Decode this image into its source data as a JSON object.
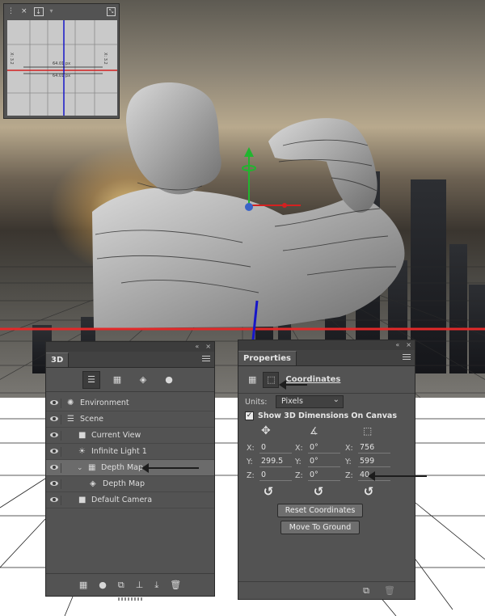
{
  "navigator": {
    "menu_icon": "flyout-menu-icon",
    "x_tag_left": "X: 3.2",
    "x_tag_right": "X: 3.2",
    "measure_top": "64.01 px",
    "measure_bottom": "64.01 px"
  },
  "panel_3d": {
    "tab": "3D",
    "collapse": "«",
    "close": "×",
    "filters": [
      {
        "icon": "scene-filter-icon",
        "active": true
      },
      {
        "icon": "mesh-filter-icon",
        "active": false
      },
      {
        "icon": "material-filter-icon",
        "active": false
      },
      {
        "icon": "light-filter-icon",
        "active": false
      }
    ],
    "layers": [
      {
        "label": "Environment",
        "icon": "environment-icon",
        "indent": 0,
        "expander": false,
        "selected": false
      },
      {
        "label": "Scene",
        "icon": "scene-icon",
        "indent": 0,
        "expander": false,
        "selected": false
      },
      {
        "label": "Current View",
        "icon": "camera-icon",
        "indent": 1,
        "expander": false,
        "selected": false
      },
      {
        "label": "Infinite Light 1",
        "icon": "infinite-light-icon",
        "indent": 1,
        "expander": false,
        "selected": false
      },
      {
        "label": "Depth Map",
        "icon": "mesh-icon",
        "indent": 1,
        "expander": true,
        "selected": true
      },
      {
        "label": "Depth Map",
        "icon": "material-icon",
        "indent": 2,
        "expander": false,
        "selected": false
      },
      {
        "label": "Default Camera",
        "icon": "camera-icon",
        "indent": 1,
        "expander": false,
        "selected": false
      }
    ],
    "bottom_tools": [
      "new-mesh-icon",
      "new-light-icon",
      "render-icon",
      "ground-icon",
      "drop-to-ground-icon",
      "trash-icon"
    ]
  },
  "properties": {
    "tab": "Properties",
    "collapse": "«",
    "close": "×",
    "section_title": "Coordinates",
    "units_label": "Units:",
    "units_value": "Pixels",
    "show_dims_label": "Show 3D Dimensions On Canvas",
    "show_dims_checked": true,
    "position": {
      "x": "0",
      "y": "299.5",
      "z": "0"
    },
    "rotation": {
      "x": "0°",
      "y": "0°",
      "z": "0°"
    },
    "scale": {
      "x": "756",
      "y": "599",
      "z": "40"
    },
    "axis_labels": {
      "x": "X:",
      "y": "Y:",
      "z": "Z:"
    },
    "reset_button": "Reset Coordinates",
    "ground_button": "Move To Ground"
  },
  "colors": {
    "panel_bg": "#535353",
    "panel_dark": "#424242",
    "selection": "#6b6b6b",
    "horizon_line": "#e32929",
    "axis_line": "#1616c9",
    "gizmo_green": "#21b52f",
    "gizmo_red": "#d32121"
  }
}
